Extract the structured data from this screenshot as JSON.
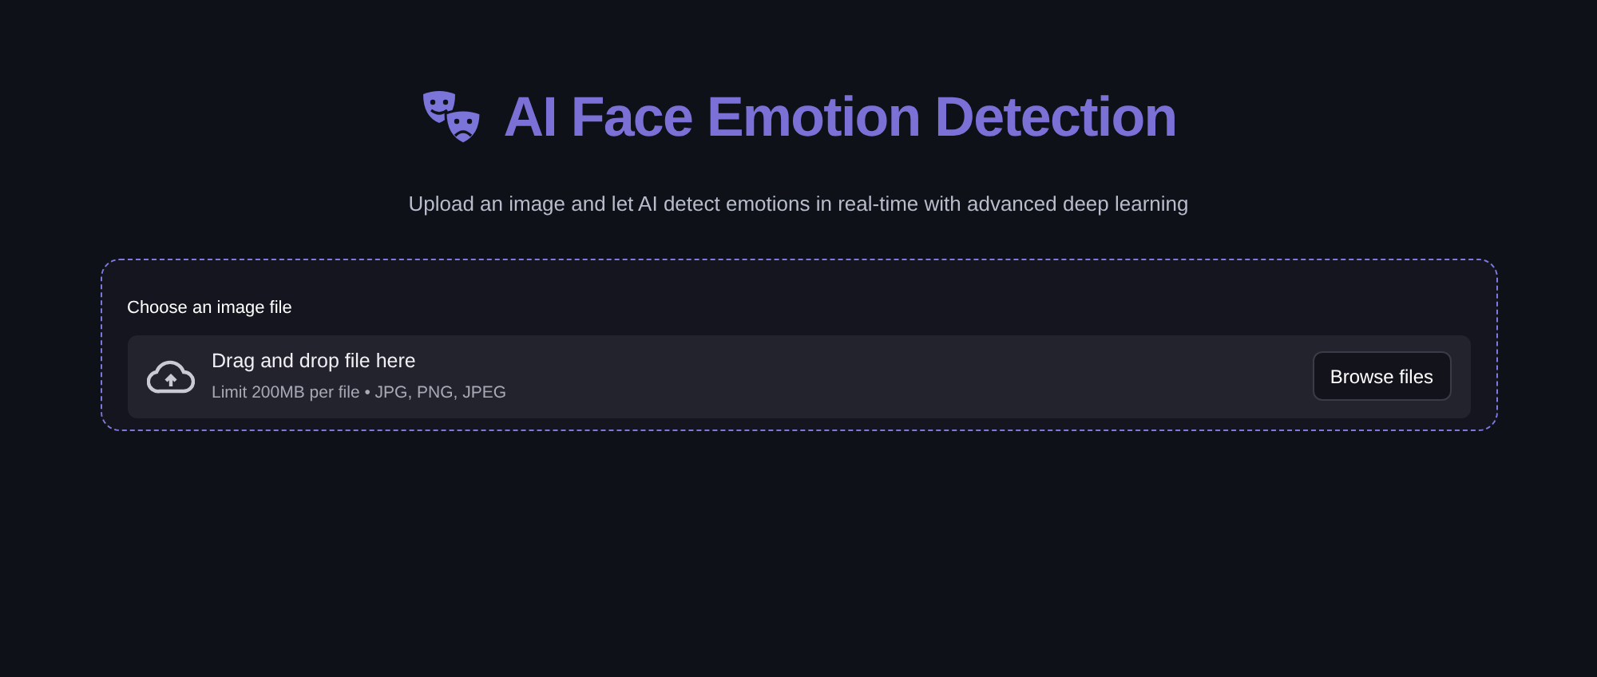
{
  "header": {
    "title": "AI Face Emotion Detection",
    "subtitle": "Upload an image and let AI detect emotions in real-time with advanced deep learning"
  },
  "uploader": {
    "label": "Choose an image file",
    "dropzone_title": "Drag and drop file here",
    "dropzone_hint": "Limit 200MB per file • JPG, PNG, JPEG",
    "button": "Browse files"
  }
}
